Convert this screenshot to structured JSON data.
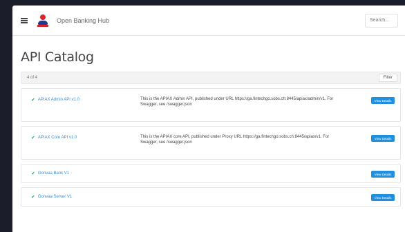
{
  "header": {
    "brand": "Open Banking Hub",
    "search_placeholder": "Search..."
  },
  "page": {
    "title": "API Catalog",
    "count": "4 of 4",
    "filter_label": "Filter"
  },
  "apis": [
    {
      "name": "APIAX Admin API v1.0",
      "description": "This is the APIAX Admin API, published under URL https://ga.fintechgo.sobs.ch:8445/apiax/admin/v1. For Swagger, see /swagger.json",
      "button": "View Details"
    },
    {
      "name": "APIAX Core API v1.0",
      "description": "This is the APIAX core API, published under Proxy URL https://ga.fintechgo.sobs.ch:8445/apiax/v1. For Swagger, see /swagger.json",
      "button": "View Details"
    },
    {
      "name": "Gonvaa Bank V1",
      "description": "",
      "button": "View Details"
    },
    {
      "name": "Gonvaa Server V1",
      "description": "",
      "button": "View Details"
    }
  ],
  "colors": {
    "accent": "#1f8fe0",
    "link": "#3b8fd6",
    "check": "#2aa876",
    "logo_red": "#d6262c",
    "logo_blue": "#213a8f"
  }
}
